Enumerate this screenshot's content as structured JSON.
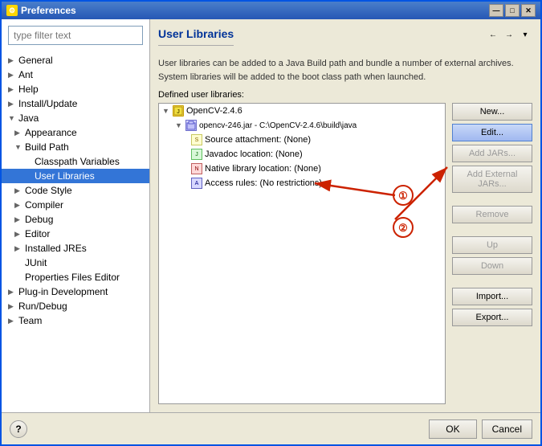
{
  "window": {
    "title": "Preferences",
    "icon": "⚙"
  },
  "title_bar_controls": {
    "minimize": "—",
    "maximize": "□",
    "close": "✕"
  },
  "left_panel": {
    "search_placeholder": "type filter text",
    "tree": [
      {
        "id": "general",
        "label": "General",
        "indent": 0,
        "arrow": "▶",
        "selected": false
      },
      {
        "id": "ant",
        "label": "Ant",
        "indent": 0,
        "arrow": "▶",
        "selected": false
      },
      {
        "id": "help",
        "label": "Help",
        "indent": 0,
        "arrow": "▶",
        "selected": false
      },
      {
        "id": "install-update",
        "label": "Install/Update",
        "indent": 0,
        "arrow": "▶",
        "selected": false
      },
      {
        "id": "java",
        "label": "Java",
        "indent": 0,
        "arrow": "▼",
        "selected": false
      },
      {
        "id": "appearance",
        "label": "Appearance",
        "indent": 1,
        "arrow": "▶",
        "selected": false
      },
      {
        "id": "build-path",
        "label": "Build Path",
        "indent": 1,
        "arrow": "▼",
        "selected": false
      },
      {
        "id": "classpath-variables",
        "label": "Classpath Variables",
        "indent": 2,
        "arrow": "",
        "selected": false
      },
      {
        "id": "user-libraries",
        "label": "User Libraries",
        "indent": 2,
        "arrow": "",
        "selected": true
      },
      {
        "id": "code-style",
        "label": "Code Style",
        "indent": 1,
        "arrow": "▶",
        "selected": false
      },
      {
        "id": "compiler",
        "label": "Compiler",
        "indent": 1,
        "arrow": "▶",
        "selected": false
      },
      {
        "id": "debug",
        "label": "Debug",
        "indent": 1,
        "arrow": "▶",
        "selected": false
      },
      {
        "id": "editor",
        "label": "Editor",
        "indent": 1,
        "arrow": "▶",
        "selected": false
      },
      {
        "id": "installed-jres",
        "label": "Installed JREs",
        "indent": 1,
        "arrow": "▶",
        "selected": false
      },
      {
        "id": "junit",
        "label": "JUnit",
        "indent": 1,
        "arrow": "",
        "selected": false
      },
      {
        "id": "properties-files-editor",
        "label": "Properties Files Editor",
        "indent": 1,
        "arrow": "",
        "selected": false
      },
      {
        "id": "plugin-development",
        "label": "Plug-in Development",
        "indent": 0,
        "arrow": "▶",
        "selected": false
      },
      {
        "id": "run-debug",
        "label": "Run/Debug",
        "indent": 0,
        "arrow": "▶",
        "selected": false
      },
      {
        "id": "team",
        "label": "Team",
        "indent": 0,
        "arrow": "▶",
        "selected": false
      }
    ]
  },
  "right_panel": {
    "title": "User Libraries",
    "description": "User libraries can be added to a Java Build path and bundle a number of external archives. System libraries will be added to the boot class path when launched.",
    "defined_label": "Defined user libraries:",
    "library_tree": [
      {
        "id": "opencv-lib",
        "label": "OpenCV-2.4.6",
        "indent": 0,
        "icon": "lib",
        "expanded": true
      },
      {
        "id": "opencv-jar",
        "label": "opencv-246.jar - C:\\OpenCV-2.4.6\\build\\java",
        "indent": 1,
        "icon": "jar",
        "expanded": true
      },
      {
        "id": "source-attach",
        "label": "Source attachment: (None)",
        "indent": 2,
        "icon": "src"
      },
      {
        "id": "javadoc-loc",
        "label": "Javadoc location: (None)",
        "indent": 2,
        "icon": "doc"
      },
      {
        "id": "native-lib",
        "label": "Native library location: (None)",
        "indent": 2,
        "icon": "native"
      },
      {
        "id": "access-rules",
        "label": "Access rules: (No restrictions)",
        "indent": 2,
        "icon": "access"
      }
    ],
    "buttons": {
      "new": "New...",
      "edit": "Edit...",
      "add_jars": "Add JARs...",
      "add_external_jars": "Add External JARs...",
      "remove": "Remove",
      "up": "Up",
      "down": "Down",
      "import": "Import...",
      "export": "Export..."
    }
  },
  "bottom": {
    "help_label": "?",
    "ok_label": "OK",
    "cancel_label": "Cancel"
  },
  "toolbar": {
    "back": "←",
    "forward": "→",
    "dropdown": "▾"
  }
}
